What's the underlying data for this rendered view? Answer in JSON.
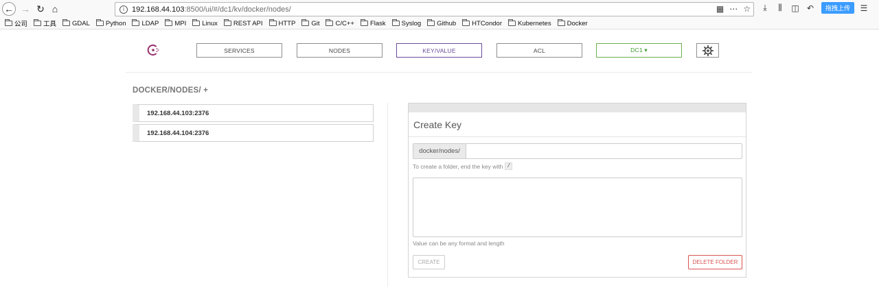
{
  "browser": {
    "url_host": "192.168.44.103",
    "url_rest": ":8500/ui/#/dc1/kv/docker/nodes/",
    "upload_label": "拖拽上传",
    "bookmarks": [
      "公司",
      "工具",
      "GDAL",
      "Python",
      "LDAP",
      "MPI",
      "Linux",
      "REST API",
      "HTTP",
      "Git",
      "C/C++",
      "Flask",
      "Syslog",
      "Github",
      "HTCondor",
      "Kubernetes",
      "Docker"
    ]
  },
  "nav": {
    "services": "SERVICES",
    "nodes": "NODES",
    "kv": "KEY/VALUE",
    "acl": "ACL",
    "dc": "DC1 ▾",
    "accent": "#694a9c",
    "dc_color": "#3a9a2a"
  },
  "breadcrumb": "DOCKER/NODES/ +",
  "keys": [
    {
      "label": "192.168.44.103:2376"
    },
    {
      "label": "192.168.44.104:2376"
    }
  ],
  "create_panel": {
    "title": "Create Key",
    "prefix": "docker/nodes/",
    "key_value": "",
    "folder_hint": "To create a folder, end the key with",
    "folder_hint_code": "/",
    "value_hint": "Value can be any format and length",
    "create_label": "CREATE",
    "delete_label": "DELETE FOLDER",
    "danger_color": "#d9534f"
  }
}
